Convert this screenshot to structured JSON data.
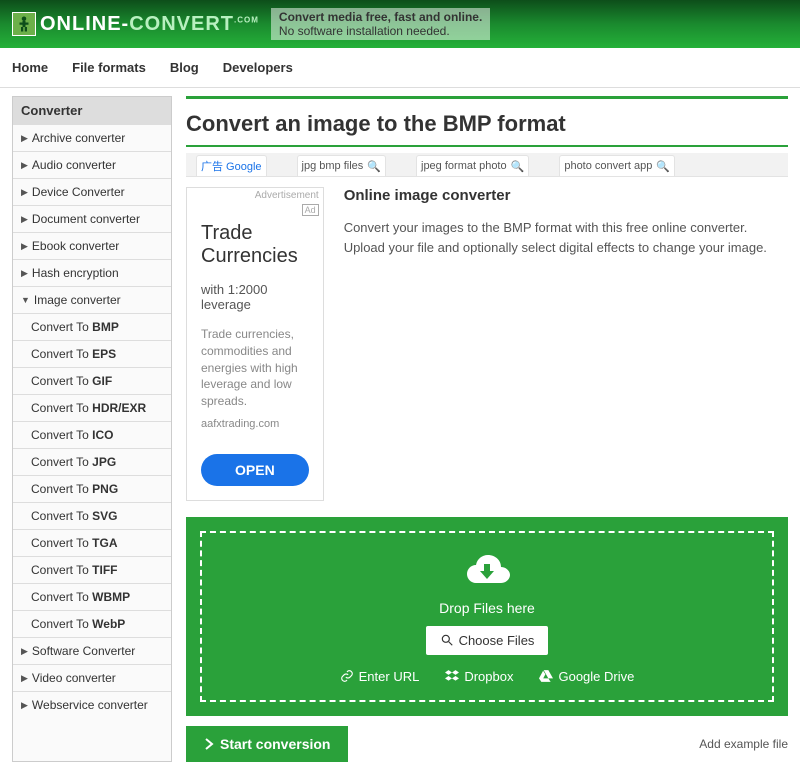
{
  "header": {
    "logo_prefix": "ONLINE-",
    "logo_suffix": "CONVERT",
    "logo_sup": ".COM",
    "tagline_bold": "Convert media free, fast and online.",
    "tagline_sub": "No software installation needed."
  },
  "nav": [
    "Home",
    "File formats",
    "Blog",
    "Developers"
  ],
  "sidebar": {
    "title": "Converter",
    "items": [
      {
        "label": "Archive converter",
        "expanded": false
      },
      {
        "label": "Audio converter",
        "expanded": false
      },
      {
        "label": "Device Converter",
        "expanded": false
      },
      {
        "label": "Document converter",
        "expanded": false
      },
      {
        "label": "Ebook converter",
        "expanded": false
      },
      {
        "label": "Hash encryption",
        "expanded": false
      },
      {
        "label": "Image converter",
        "expanded": true,
        "children": [
          {
            "prefix": "Convert To ",
            "fmt": "BMP"
          },
          {
            "prefix": "Convert To ",
            "fmt": "EPS"
          },
          {
            "prefix": "Convert To ",
            "fmt": "GIF"
          },
          {
            "prefix": "Convert To ",
            "fmt": "HDR/EXR"
          },
          {
            "prefix": "Convert To ",
            "fmt": "ICO"
          },
          {
            "prefix": "Convert To ",
            "fmt": "JPG"
          },
          {
            "prefix": "Convert To ",
            "fmt": "PNG"
          },
          {
            "prefix": "Convert To ",
            "fmt": "SVG"
          },
          {
            "prefix": "Convert To ",
            "fmt": "TGA"
          },
          {
            "prefix": "Convert To ",
            "fmt": "TIFF"
          },
          {
            "prefix": "Convert To ",
            "fmt": "WBMP"
          },
          {
            "prefix": "Convert To ",
            "fmt": "WebP"
          }
        ]
      },
      {
        "label": "Software Converter",
        "expanded": false
      },
      {
        "label": "Video converter",
        "expanded": false
      },
      {
        "label": "Webservice converter",
        "expanded": false
      }
    ]
  },
  "page": {
    "title": "Convert an image to the BMP format",
    "ad_tabs": [
      {
        "label": "广告 Google",
        "google": true
      },
      {
        "label": "jpg bmp files"
      },
      {
        "label": "jpeg format photo"
      },
      {
        "label": "photo convert app"
      }
    ],
    "ad": {
      "top_label": "Advertisement",
      "corner": "Ad",
      "title": "Trade Currencies",
      "sub": "with 1:2000 leverage",
      "body": "Trade currencies, commodities and energies with high leverage and low spreads.",
      "domain": "aafxtrading.com",
      "button": "OPEN"
    },
    "intro": {
      "heading": "Online image converter",
      "body": "Convert your images to the BMP format with this free online converter. Upload your file and optionally select digital effects to change your image."
    },
    "dropzone": {
      "drop_label": "Drop Files here",
      "choose_label": "Choose Files",
      "sources": [
        "Enter URL",
        "Dropbox",
        "Google Drive"
      ]
    },
    "start_label": "Start conversion",
    "example_link": "Add example file"
  }
}
